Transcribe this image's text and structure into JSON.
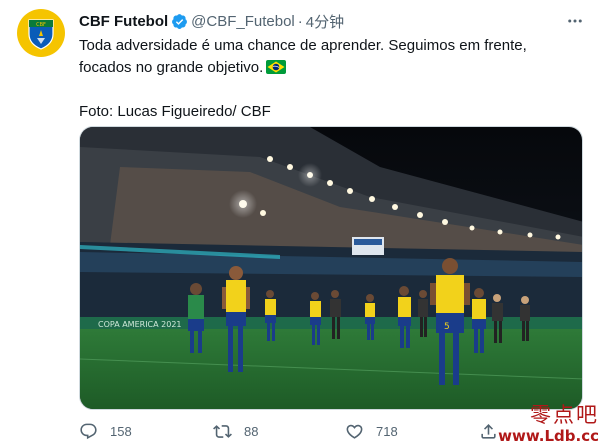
{
  "tweet": {
    "author_name": "CBF Futebol",
    "handle": "@CBF_Futebol",
    "separator": "·",
    "time": "4分钟",
    "text_line1": "Toda adversidade é uma chance de aprender. Seguimos em frente,",
    "text_line2": "focados no grande objetivo.",
    "photo_credit": "Foto: Lucas Figueiredo/ CBF",
    "flag_icon": "brazil-flag-icon",
    "stadium_banner": "COPA AMERICA 2021"
  },
  "actions": {
    "reply_count": "158",
    "retweet_count": "88",
    "like_count": "718"
  },
  "watermark": {
    "chinese": "零点吧",
    "url": "www.Ldb.cc"
  },
  "colors": {
    "accent": "#1d9bf0",
    "text_secondary": "#536471",
    "watermark": "#b01818"
  }
}
